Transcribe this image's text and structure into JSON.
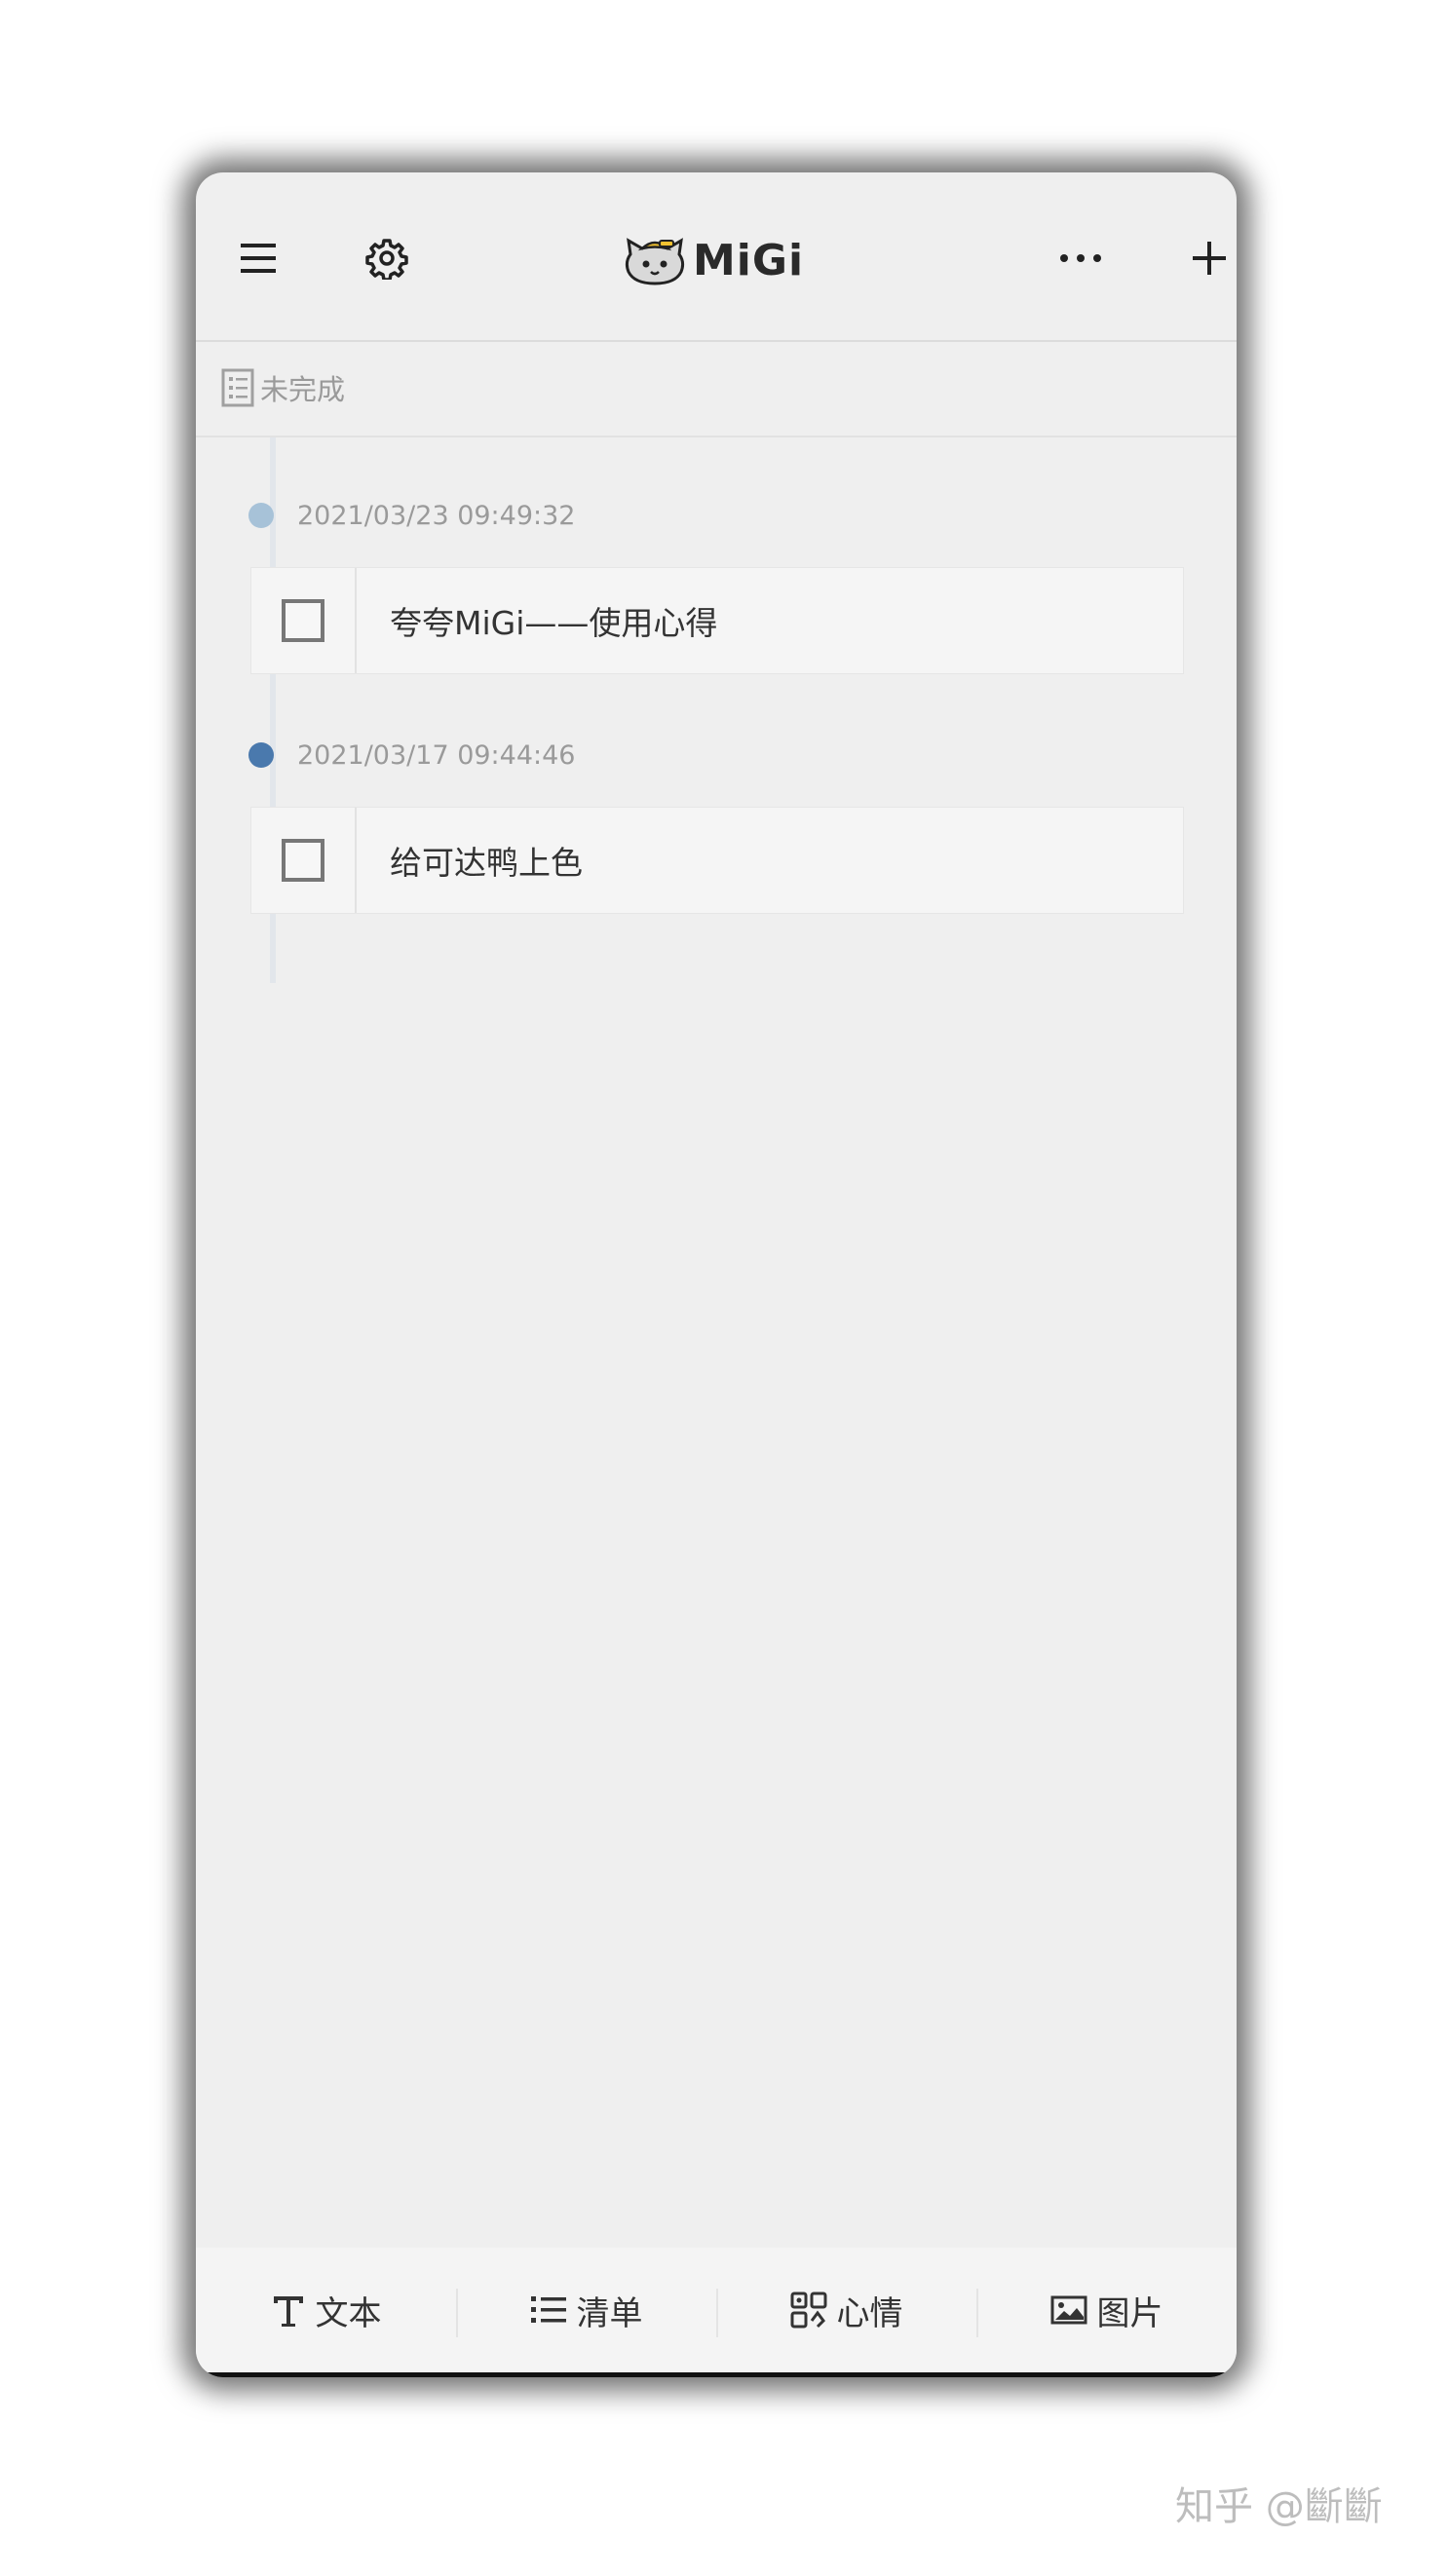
{
  "app": {
    "title": "MiGi",
    "accent": "#4a7bb0"
  },
  "header": {
    "menu_icon": "hamburger-menu-icon",
    "settings_icon": "gear-icon",
    "more_icon": "more-dots-icon",
    "add_icon": "plus-icon",
    "logo_icon": "cat-logo-icon"
  },
  "section": {
    "icon": "checklist-icon",
    "label": "未完成"
  },
  "entries": [
    {
      "date": "2021/03/23 09:49:32",
      "text": "夸夸MiGi——使用心得",
      "dot_color": "#a7c2d8"
    },
    {
      "date": "2021/03/17 09:44:46",
      "text": "给可达鸭上色",
      "dot_color": "#4a79ad"
    }
  ],
  "bottom_bar": [
    {
      "icon": "text-icon",
      "label": "文本"
    },
    {
      "icon": "list-icon",
      "label": "清单"
    },
    {
      "icon": "mood-icon",
      "label": "心情"
    },
    {
      "icon": "image-icon",
      "label": "图片"
    }
  ],
  "watermark": "知乎 @斷斷"
}
